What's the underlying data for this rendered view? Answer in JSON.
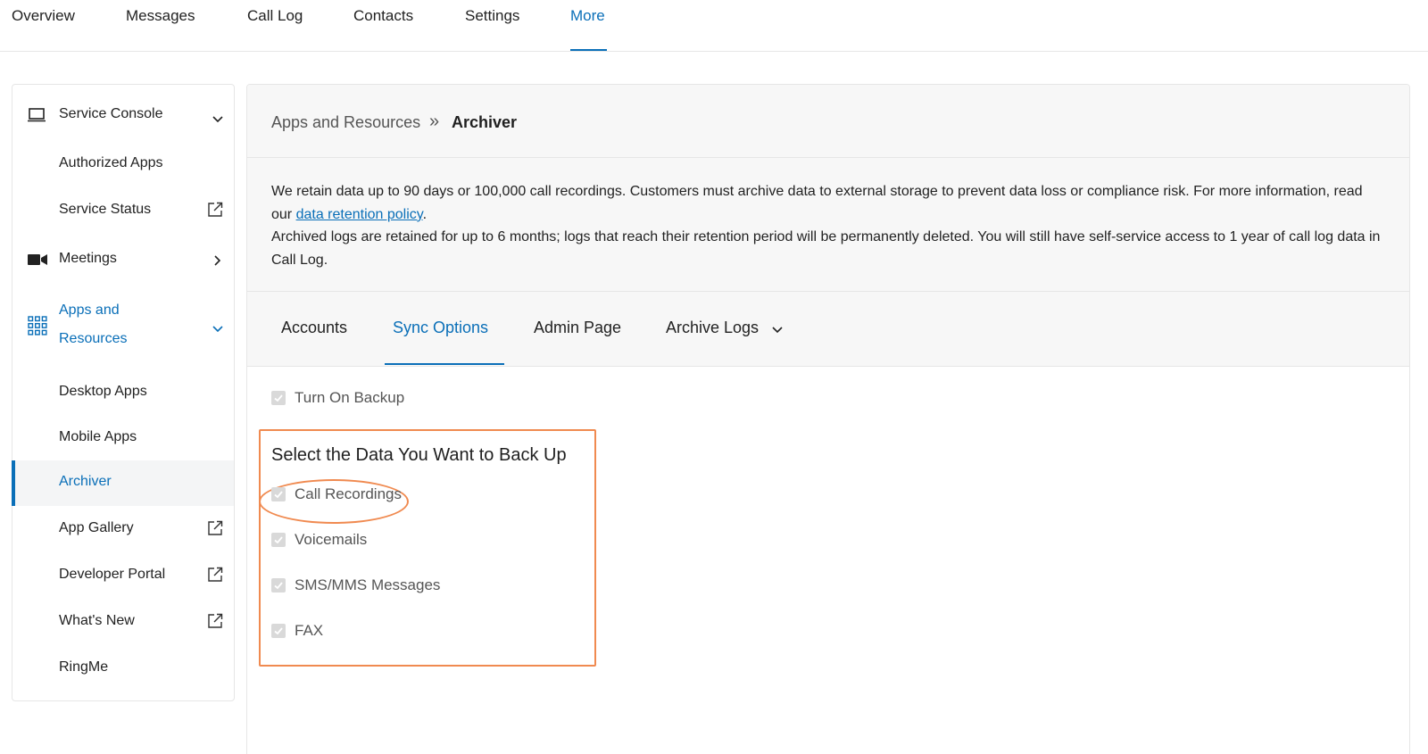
{
  "topnav": {
    "tabs": [
      {
        "label": "Overview"
      },
      {
        "label": "Messages"
      },
      {
        "label": "Call Log"
      },
      {
        "label": "Contacts"
      },
      {
        "label": "Settings"
      },
      {
        "label": "More"
      }
    ],
    "active": "More"
  },
  "sidebar": {
    "items": [
      {
        "label": "Service Console",
        "icon": "laptop-icon",
        "chevron": "chevron-down-icon"
      },
      {
        "label": "Authorized Apps"
      },
      {
        "label": "Service Status",
        "icon": "external-link-icon"
      },
      {
        "label": "Meetings",
        "icon": "video-camera-icon",
        "chevron": "chevron-right-icon"
      },
      {
        "label_line1": "Apps and",
        "label_line2": "Resources",
        "icon": "grid-icon",
        "chevron": "chevron-down-icon"
      },
      {
        "label": "Desktop Apps"
      },
      {
        "label": "Mobile Apps"
      },
      {
        "label": "Archiver",
        "selected": true
      },
      {
        "label": "App Gallery",
        "icon": "external-link-icon"
      },
      {
        "label": "Developer Portal",
        "icon": "external-link-icon"
      },
      {
        "label": "What's New",
        "icon": "external-link-icon"
      },
      {
        "label": "RingMe"
      }
    ]
  },
  "breadcrumb": {
    "parent": "Apps and Resources",
    "separator": "»",
    "current": "Archiver"
  },
  "info": {
    "p1_before": "We retain data up to 90 days or 100,000 call recordings. Customers must archive data to external storage to prevent data loss or compliance risk. For more information, read our ",
    "p1_link": "data retention policy",
    "p1_after": ".",
    "p2": "Archived logs are retained for up to 6 months; logs that reach their retention period will be permanently deleted. You will still have self-service access to 1 year of call log data in Call Log."
  },
  "subtabs": {
    "items": [
      {
        "label": "Accounts"
      },
      {
        "label": "Sync Options"
      },
      {
        "label": "Admin Page"
      },
      {
        "label": "Archive Logs"
      }
    ],
    "active": "Sync Options"
  },
  "backup": {
    "turn_on_label": "Turn On Backup",
    "turn_on_checked": true,
    "select_title": "Select the Data You Want to Back Up",
    "options": [
      {
        "label": "Call Recordings",
        "checked": true
      },
      {
        "label": "Voicemails",
        "checked": true
      },
      {
        "label": "SMS/MMS Messages",
        "checked": true
      },
      {
        "label": "FAX",
        "checked": true
      }
    ]
  },
  "colors": {
    "accent": "#0a6fb8",
    "annotation": "#f08a50",
    "checkbox_disabled": "#d9d9d9"
  }
}
